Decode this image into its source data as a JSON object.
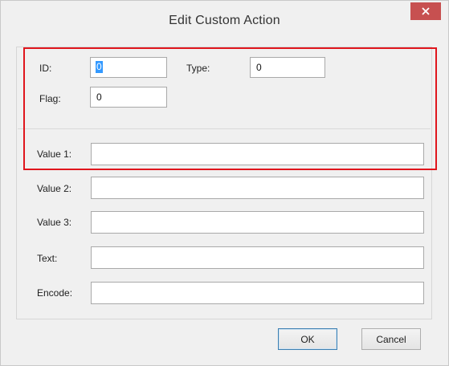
{
  "window": {
    "title": "Edit Custom Action",
    "close_icon": "close-icon"
  },
  "form": {
    "id": {
      "label": "ID:",
      "value": "0"
    },
    "type": {
      "label": "Type:",
      "value": "0"
    },
    "flag": {
      "label": "Flag:",
      "value": "0"
    },
    "value1": {
      "label": "Value 1:",
      "value": ""
    },
    "value2": {
      "label": "Value 2:",
      "value": ""
    },
    "value3": {
      "label": "Value 3:",
      "value": ""
    },
    "text": {
      "label": "Text:",
      "value": ""
    },
    "encode": {
      "label": "Encode:",
      "value": ""
    }
  },
  "buttons": {
    "ok_label": "OK",
    "cancel_label": "Cancel"
  },
  "colors": {
    "close_button": "#c75050",
    "highlight_border": "#e0161d",
    "selection": "#3399ff"
  }
}
